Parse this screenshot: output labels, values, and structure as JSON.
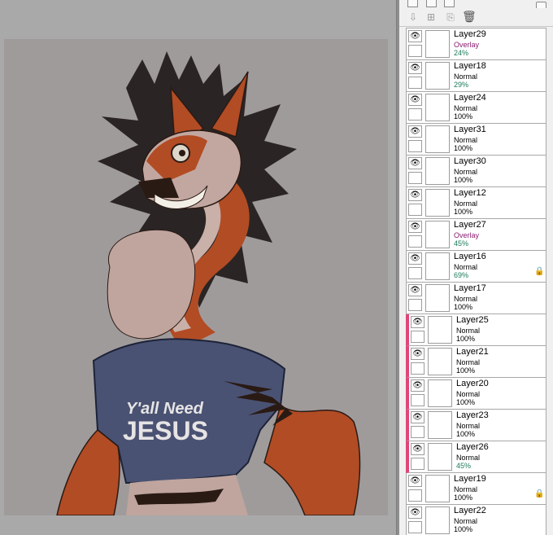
{
  "colors": {
    "canvas_bg": "#a09b9b",
    "workspace_bg": "#a9a9a9",
    "clip_marker": "#e0457a",
    "overlay_mode": "#8a1b6f",
    "opacity_partial": "#1a7a5a"
  },
  "toolbar": {
    "icons": [
      "new-raster-layer-icon",
      "new-folder-icon",
      "copy-layer-icon",
      "merge-down-icon",
      "delete-layer-icon"
    ]
  },
  "artwork": {
    "shirt_line1": "Y'all Need",
    "shirt_line2": "JESUS"
  },
  "layers": [
    {
      "name": "Layer29",
      "mode": "Overlay",
      "opacity": "24%",
      "clipped": false,
      "locked": false
    },
    {
      "name": "Layer18",
      "mode": "Normal",
      "opacity": "29%",
      "clipped": false,
      "locked": false
    },
    {
      "name": "Layer24",
      "mode": "Normal",
      "opacity": "100%",
      "clipped": false,
      "locked": false
    },
    {
      "name": "Layer31",
      "mode": "Normal",
      "opacity": "100%",
      "clipped": false,
      "locked": false
    },
    {
      "name": "Layer30",
      "mode": "Normal",
      "opacity": "100%",
      "clipped": false,
      "locked": false
    },
    {
      "name": "Layer12",
      "mode": "Normal",
      "opacity": "100%",
      "clipped": false,
      "locked": false
    },
    {
      "name": "Layer27",
      "mode": "Overlay",
      "opacity": "45%",
      "clipped": false,
      "locked": false
    },
    {
      "name": "Layer16",
      "mode": "Normal",
      "opacity": "69%",
      "clipped": false,
      "locked": true
    },
    {
      "name": "Layer17",
      "mode": "Normal",
      "opacity": "100%",
      "clipped": false,
      "locked": false
    },
    {
      "name": "Layer25",
      "mode": "Normal",
      "opacity": "100%",
      "clipped": true,
      "locked": false
    },
    {
      "name": "Layer21",
      "mode": "Normal",
      "opacity": "100%",
      "clipped": true,
      "locked": false
    },
    {
      "name": "Layer20",
      "mode": "Normal",
      "opacity": "100%",
      "clipped": true,
      "locked": false
    },
    {
      "name": "Layer23",
      "mode": "Normal",
      "opacity": "100%",
      "clipped": true,
      "locked": false
    },
    {
      "name": "Layer26",
      "mode": "Normal",
      "opacity": "45%",
      "clipped": true,
      "locked": false
    },
    {
      "name": "Layer19",
      "mode": "Normal",
      "opacity": "100%",
      "clipped": false,
      "locked": true
    },
    {
      "name": "Layer22",
      "mode": "Normal",
      "opacity": "100%",
      "clipped": false,
      "locked": false
    }
  ]
}
